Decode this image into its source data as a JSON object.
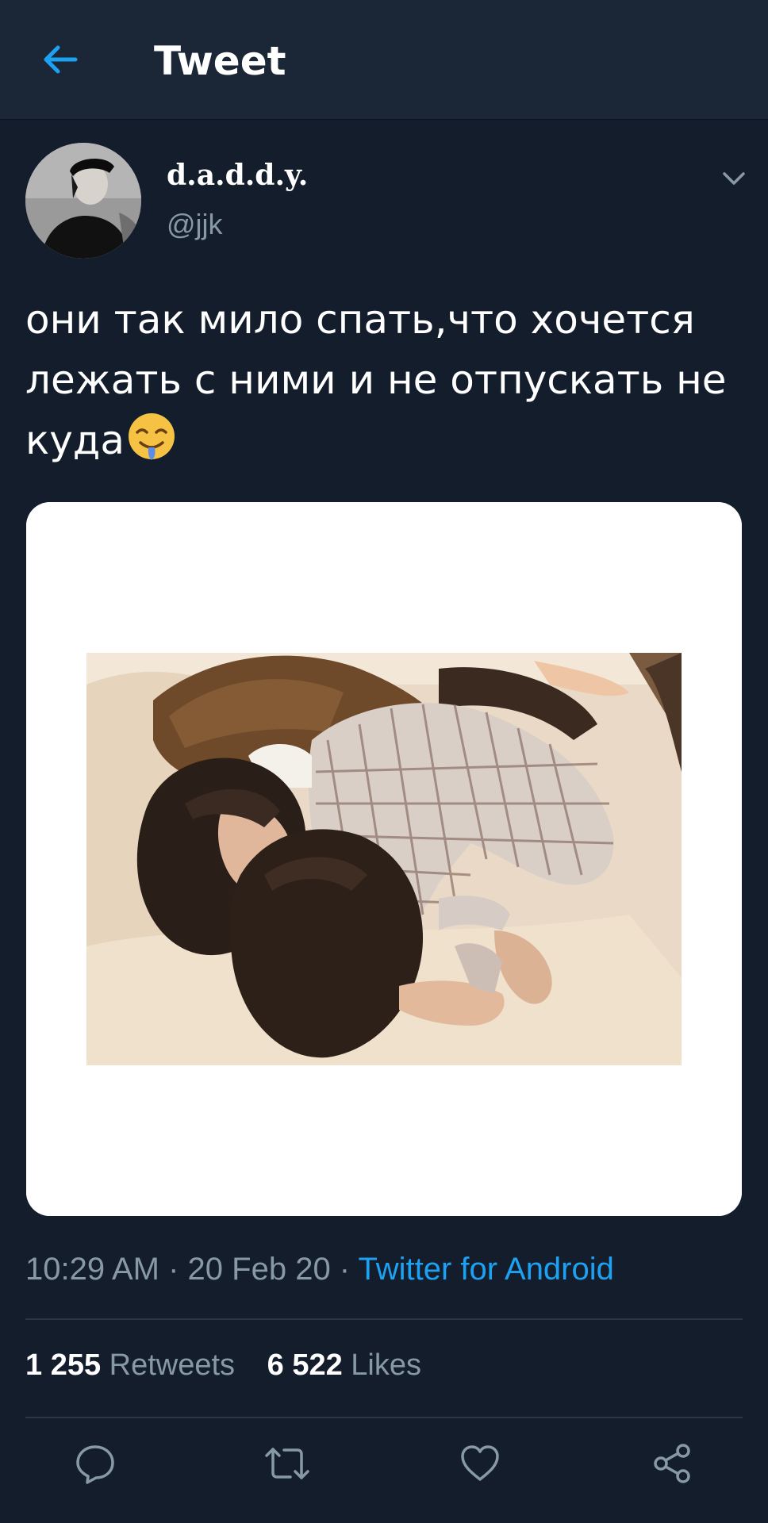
{
  "header": {
    "title": "Tweet",
    "back_icon": "arrow-left-icon",
    "accent": "#1da1f2"
  },
  "tweet": {
    "display_name": "d.a.d.d.y.",
    "handle": "@jjk",
    "text": "они так мило спать,что хочется лежать с ними и не отпускать не куда",
    "emoji": "drooling-face-emoji",
    "timestamp": "10:29 AM · 20 Feb 20 · ",
    "source": "Twitter for Android",
    "retweets_count": "1 255",
    "retweets_label": "Retweets",
    "likes_count": "6 522",
    "likes_label": "Likes"
  },
  "actions": {
    "reply": "reply-icon",
    "retweet": "retweet-icon",
    "like": "heart-icon",
    "share": "share-icon"
  },
  "colors": {
    "background": "#141d2b",
    "header_bg": "#1b2637",
    "secondary_text": "#8899a6",
    "link": "#1da1f2"
  }
}
